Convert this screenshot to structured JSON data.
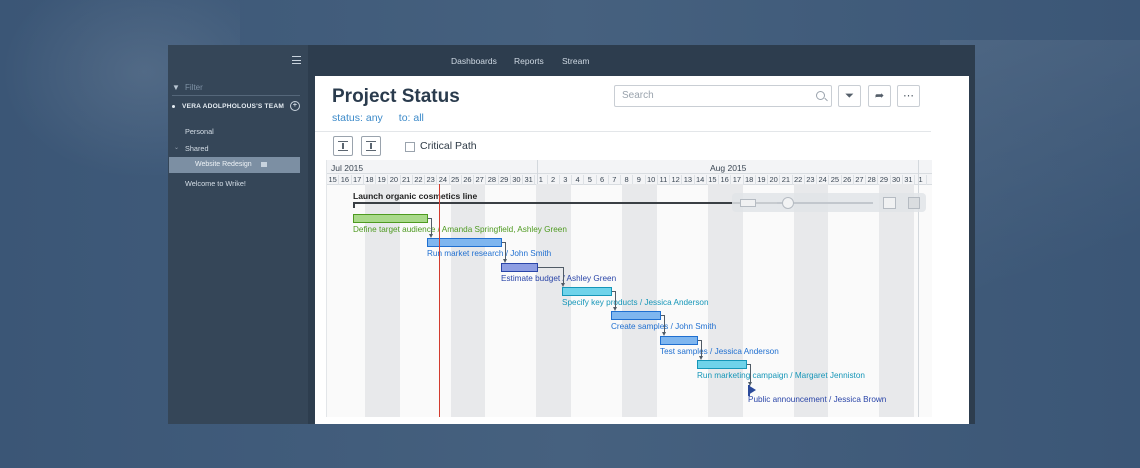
{
  "topnav": {
    "items": [
      "Dashboards",
      "Reports",
      "Stream"
    ]
  },
  "sidebar": {
    "filter_placeholder": "Filter",
    "team": "VERA ADOLPHOLOUS'S TEAM",
    "items": [
      "Personal",
      "Shared",
      "Website Redesign",
      "Welcome to Wrike!"
    ]
  },
  "header": {
    "title": "Project Status",
    "status_filter": "status: any",
    "to_filter": "to: all",
    "search_placeholder": "Search"
  },
  "toolbar": {
    "critical_path_label": "Critical Path",
    "critical_path_checked": false
  },
  "gantt": {
    "months": [
      "Jul 2015",
      "Aug 2015"
    ],
    "days": [
      "15",
      "16",
      "17",
      "18",
      "19",
      "20",
      "21",
      "22",
      "23",
      "24",
      "25",
      "26",
      "27",
      "28",
      "29",
      "30",
      "31",
      "1",
      "2",
      "3",
      "4",
      "5",
      "6",
      "7",
      "8",
      "9",
      "10",
      "11",
      "12",
      "13",
      "14",
      "15",
      "16",
      "17",
      "18",
      "19",
      "20",
      "21",
      "22",
      "23",
      "24",
      "25",
      "26",
      "27",
      "28",
      "29",
      "30",
      "31",
      "1"
    ],
    "project_name": "Launch organic cosmetics line",
    "tasks": [
      {
        "label": "Define target audience / Amanda Springfield, Ashley Green",
        "color": "#a9d98a",
        "text_color": "#4e9a20"
      },
      {
        "label": "Run market research / John Smith",
        "color": "#7fb6ef",
        "text_color": "#1f6fd0"
      },
      {
        "label": "Estimate budget / Ashley Green",
        "color": "#8e9ee3",
        "text_color": "#2a45a8"
      },
      {
        "label": "Specify key products / Jessica Anderson",
        "color": "#6fd3ea",
        "text_color": "#1596b8"
      },
      {
        "label": "Create samples / John Smith",
        "color": "#7fb6ef",
        "text_color": "#1f6fd0"
      },
      {
        "label": "Test samples / Jessica Anderson",
        "color": "#7fb6ef",
        "text_color": "#1f6fd0"
      },
      {
        "label": "Run marketing campaign / Margaret  Jenniston",
        "color": "#6fd3ea",
        "text_color": "#1596b8"
      },
      {
        "label": "Public announcement / Jessica Brown",
        "color": "#2b4a9a",
        "text_color": "#2a45a8"
      }
    ]
  }
}
